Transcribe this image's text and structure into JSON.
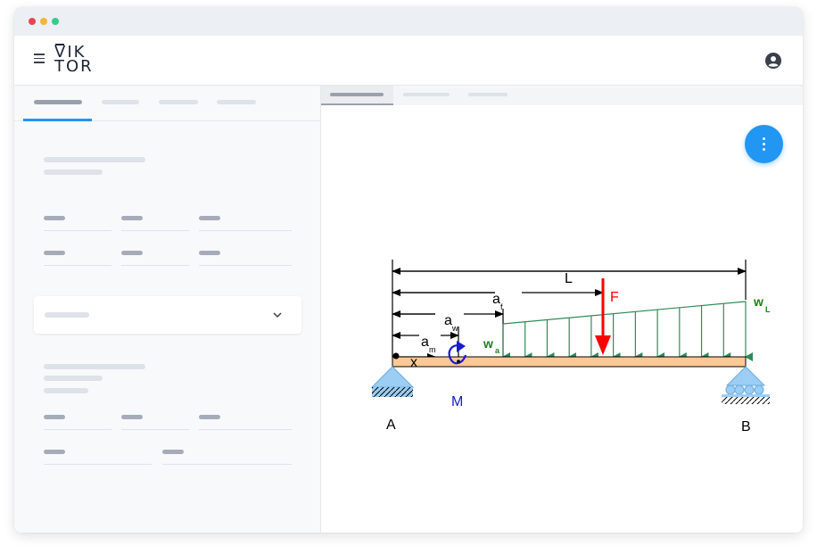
{
  "window": {
    "controls": {
      "close_color": "#e8464f",
      "minimize_color": "#f5b43b",
      "maximize_color": "#2fcf8a"
    }
  },
  "appbar": {
    "logo_line1": "VIK",
    "logo_line2": "TOR",
    "menu_icon": "hamburger-icon",
    "user_icon": "user-circle-icon"
  },
  "left_panel": {
    "tabs": [
      "",
      "",
      "",
      ""
    ],
    "active_tab": 0,
    "accent_color": "#2196f3",
    "collapsed_section_icon": "chevron-down-icon"
  },
  "right_panel": {
    "tabs": [
      "",
      "",
      ""
    ],
    "active_tab": 0,
    "fab_icon": "more-vertical-icon",
    "fab_color": "#2196f3"
  },
  "diagram": {
    "labels": {
      "length": "L",
      "force_offset": "a",
      "force_offset_sub": "f",
      "force": "F",
      "load_end": "w",
      "load_end_sub": "L",
      "load_offset": "a",
      "load_offset_sub": "w",
      "load_start": "w",
      "load_start_sub": "a",
      "moment_offset": "a",
      "moment_offset_sub": "m",
      "position": "x",
      "moment": "M",
      "support_a": "A",
      "support_b": "B"
    },
    "colors": {
      "beam": "#fbc896",
      "force": "#ff0000",
      "load": "#2e8b57",
      "moment": "#1a1acd",
      "support": "#9ccdf2",
      "label_green": "#1d7f1d"
    },
    "load_arrow_count": 12
  }
}
